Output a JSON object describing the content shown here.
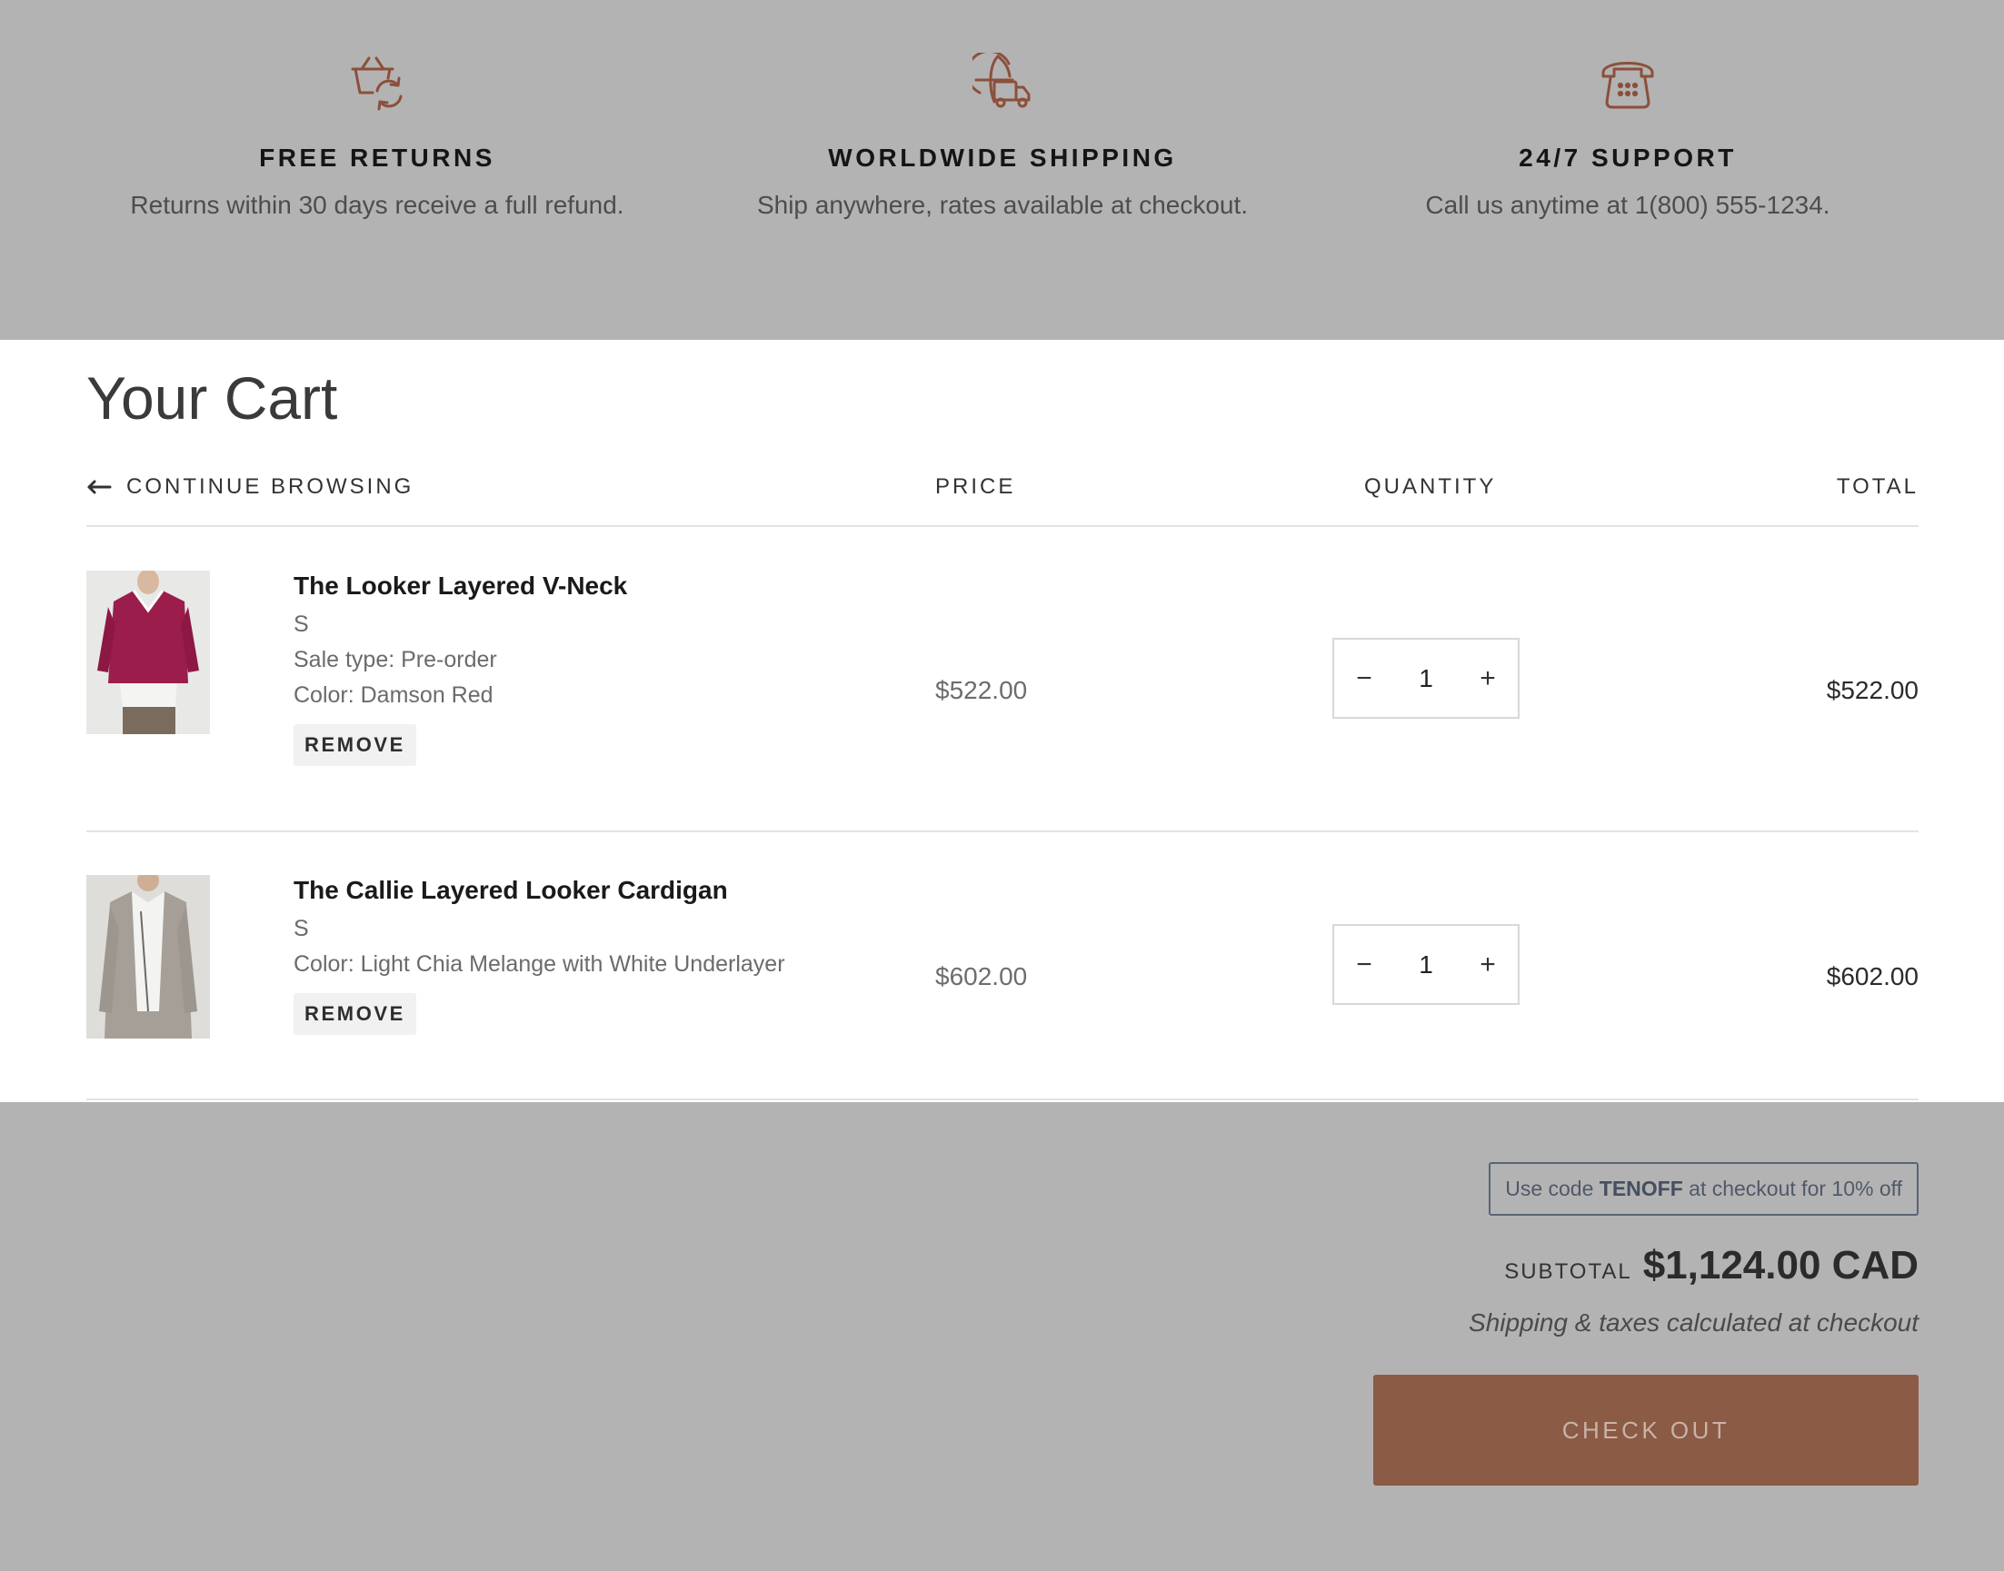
{
  "features": [
    {
      "icon": "basket-refresh-icon",
      "title": "FREE RETURNS",
      "text": "Returns within 30 days receive a full refund."
    },
    {
      "icon": "globe-truck-icon",
      "title": "WORLDWIDE SHIPPING",
      "text": "Ship anywhere, rates available at checkout."
    },
    {
      "icon": "telephone-icon",
      "title": "24/7 SUPPORT",
      "text": "Call us anytime at 1(800) 555-1234."
    }
  ],
  "cart": {
    "title": "Your Cart",
    "continue_label": "CONTINUE BROWSING",
    "headers": {
      "price": "PRICE",
      "quantity": "QUANTITY",
      "total": "TOTAL"
    },
    "items": [
      {
        "name": "The Looker Layered V-Neck",
        "size": "S",
        "sale_type": "Sale type: Pre-order",
        "color": "Color: Damson Red",
        "remove_label": "REMOVE",
        "price": "$522.00",
        "quantity": "1",
        "total": "$522.00"
      },
      {
        "name": "The Callie Layered Looker Cardigan",
        "size": "S",
        "color": "Color: Light Chia Melange with White Underlayer",
        "remove_label": "REMOVE",
        "price": "$602.00",
        "quantity": "1",
        "total": "$602.00"
      }
    ],
    "quantity_controls": {
      "decrease": "−",
      "increase": "+"
    }
  },
  "summary": {
    "promo_prefix": "Use code ",
    "promo_code": "TENOFF",
    "promo_suffix": " at checkout for 10% off",
    "subtotal_label": "SUBTOTAL",
    "subtotal_value": "$1,124.00 CAD",
    "shipping_note": "Shipping & taxes calculated at checkout",
    "checkout_label": "CHECK OUT"
  },
  "colors": {
    "accent": "#8b5b45",
    "icon": "#8c4f3b",
    "overlay": "#b3b3b3",
    "promo_border": "#5a6474"
  }
}
